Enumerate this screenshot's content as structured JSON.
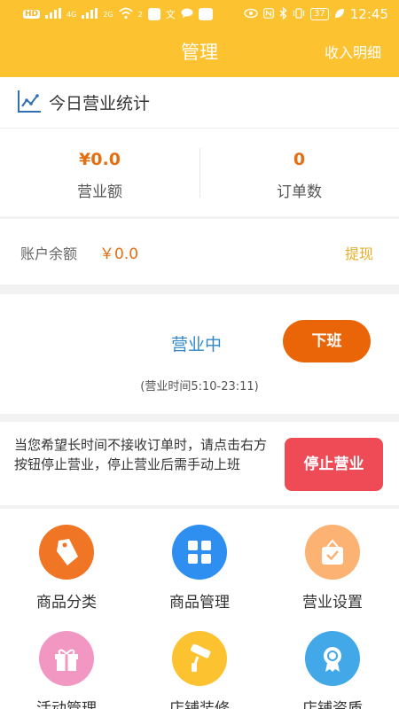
{
  "status_bar": {
    "left_badge": "HD",
    "signal_1": "4G",
    "signal_2": "2G",
    "wifi_badge": "2",
    "battery": "37",
    "time": "12:45"
  },
  "app_bar": {
    "title": "管理",
    "action": "收入明细"
  },
  "today_stats": {
    "title": "今日营业统计",
    "revenue_value": "¥0.0",
    "revenue_label": "营业额",
    "orders_value": "0",
    "orders_label": "订单数"
  },
  "balance": {
    "label": "账户余额",
    "value": "￥0.0",
    "withdraw": "提现"
  },
  "business_status": {
    "status": "营业中",
    "button": "下班",
    "hours": "(营业时间5:10-23:11)"
  },
  "stop_business": {
    "description": "当您希望长时间不接收订单时，请点击右方按钮停止营业，停止营业后需手动上班",
    "button": "停止营业"
  },
  "menu": [
    {
      "label": "商品分类",
      "icon": "tag-icon",
      "color": "#f07525"
    },
    {
      "label": "商品管理",
      "icon": "grid-icon",
      "color": "#2e8ff0"
    },
    {
      "label": "营业设置",
      "icon": "shopping-bag-check-icon",
      "color": "#fbb272"
    },
    {
      "label": "活动管理",
      "icon": "gift-icon",
      "color": "#f197c2"
    },
    {
      "label": "店铺装修",
      "icon": "paint-roller-icon",
      "color": "#fcc22f"
    },
    {
      "label": "店铺资质",
      "icon": "award-ribbon-icon",
      "color": "#43a8e8"
    }
  ],
  "colors": {
    "brand": "#fcc22f",
    "accent_orange": "#e46e12",
    "link_blue": "#3188c9",
    "danger": "#ee4b56"
  }
}
